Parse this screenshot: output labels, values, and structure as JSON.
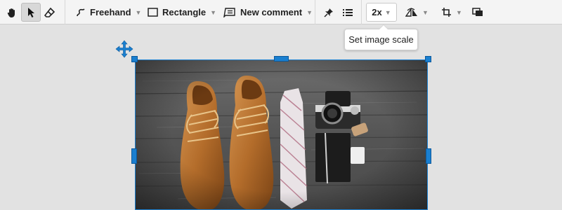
{
  "toolbar": {
    "freehand_label": "Freehand",
    "rectangle_label": "Rectangle",
    "comment_label": "New comment",
    "scale_label": "2x"
  },
  "tooltip": {
    "text": "Set image scale"
  },
  "icons": {
    "pan": "hand-icon",
    "select": "pointer-icon",
    "erase": "eraser-icon",
    "freehand": "freehand-icon",
    "rectangle": "rectangle-icon",
    "comment": "comment-icon",
    "pin": "pin-icon",
    "list": "list-icon",
    "flip": "flip-icon",
    "crop": "crop-icon",
    "layers": "layers-icon",
    "move": "move-icon"
  },
  "colors": {
    "accent": "#1a7fd0",
    "toolbar_bg": "#f4f4f4",
    "canvas_bg": "#e2e2e2"
  }
}
